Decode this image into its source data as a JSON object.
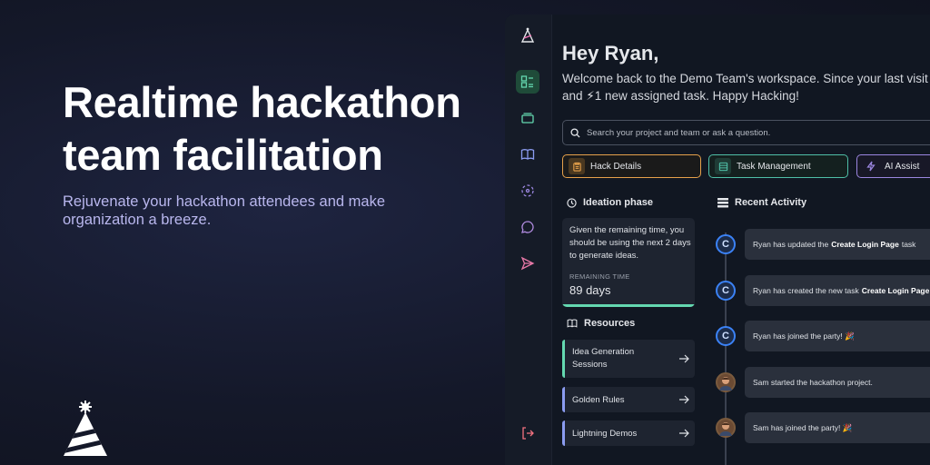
{
  "hero": {
    "title": "Realtime hackathon team facilitation",
    "subtitle": "Rejuvenate your hackathon attendees and make organization a breeze."
  },
  "app": {
    "greeting": "Hey Ryan,",
    "welcome_line1": "Welcome back to the Demo Team's workspace. Since your last visit",
    "welcome_line2_prefix": "and",
    "welcome_line2_count": "1 new assigned task. Happy Hacking!",
    "search": {
      "placeholder": "Search your project and team or ask a question."
    },
    "quick_actions": [
      {
        "label": "Hack Details",
        "icon": "clipboard-icon",
        "color": "#e6a14b"
      },
      {
        "label": "Task Management",
        "icon": "list-icon",
        "color": "#4fbfa7"
      },
      {
        "label": "AI Assist",
        "icon": "bolt-icon",
        "color": "#9b86e0"
      }
    ],
    "phase": {
      "title": "Ideation phase",
      "description": "Given the remaining time, you should be using the next 2 days to generate ideas.",
      "remaining_label": "REMAINING TIME",
      "remaining_value": "89 days",
      "progress": 1.0
    },
    "resources": {
      "title": "Resources",
      "items": [
        {
          "label": "Idea Generation Sessions",
          "color": "#64d8b0"
        },
        {
          "label": "Golden Rules",
          "color": "#8b9cf0"
        },
        {
          "label": "Lightning Demos",
          "color": "#8b9cf0"
        }
      ]
    },
    "activity": {
      "title": "Recent Activity",
      "items": [
        {
          "avatar": "C",
          "pre": "Ryan has updated the",
          "bold": "Create Login Page",
          "post": "task"
        },
        {
          "avatar": "C",
          "pre": "Ryan has created the new task",
          "bold": "Create Login Page",
          "post": ""
        },
        {
          "avatar": "C",
          "pre": "Ryan has joined the party! 🎉",
          "bold": "",
          "post": ""
        },
        {
          "avatar": "photo",
          "pre": "Sam started the hackathon project.",
          "bold": "",
          "post": ""
        },
        {
          "avatar": "photo",
          "pre": "Sam has joined the party! 🎉",
          "bold": "",
          "post": ""
        }
      ]
    },
    "accent_green": "#64d8b0"
  }
}
